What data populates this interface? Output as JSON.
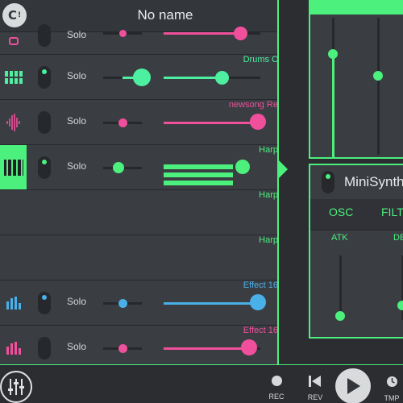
{
  "app": {
    "title": "No name",
    "logo_text": "C"
  },
  "tracks": [
    {
      "name": "",
      "solo": "Solo",
      "icon": "pads-icon",
      "color": "#f0509b",
      "pan": 0.5,
      "volume": 0.8
    },
    {
      "name": "Drums C",
      "solo": "Solo",
      "icon": "drum-pads-icon",
      "color": "#4cf0a0",
      "pan": 1.0,
      "volume": 0.6
    },
    {
      "name": "newsong Re",
      "solo": "Solo",
      "icon": "waveform-icon",
      "color": "#f0509b",
      "pan": 0.5,
      "volume": 0.97
    },
    {
      "name": "Harp",
      "solo": "Solo",
      "icon": "piano-keys-icon",
      "color": "#4cf07d",
      "pan": 0.4,
      "volume": 0.85
    },
    {
      "name": "Harp"
    },
    {
      "name": "Harp"
    },
    {
      "name": "Effect 16",
      "solo": "Solo",
      "icon": "equalizer-icon",
      "color": "#4ab0e8",
      "pan": 0.5,
      "volume": 0.97
    },
    {
      "name": "Effect 16",
      "solo": "Solo",
      "icon": "equalizer-icon",
      "color": "#f0509b",
      "pan": 0.5,
      "volume": 0.88
    }
  ],
  "synth": {
    "name": "MiniSynth",
    "tabs": [
      "OSC",
      "FILT"
    ],
    "knobs": [
      "ATK",
      "DEC"
    ],
    "attack": 0.05,
    "decay": 0.2
  },
  "transport": {
    "rec_label": "REC",
    "rev_label": "REV",
    "tmp_label": "TMP"
  },
  "colors": {
    "accent": "#4cf07d",
    "pink": "#f0509b",
    "blue": "#4ab0e8"
  }
}
